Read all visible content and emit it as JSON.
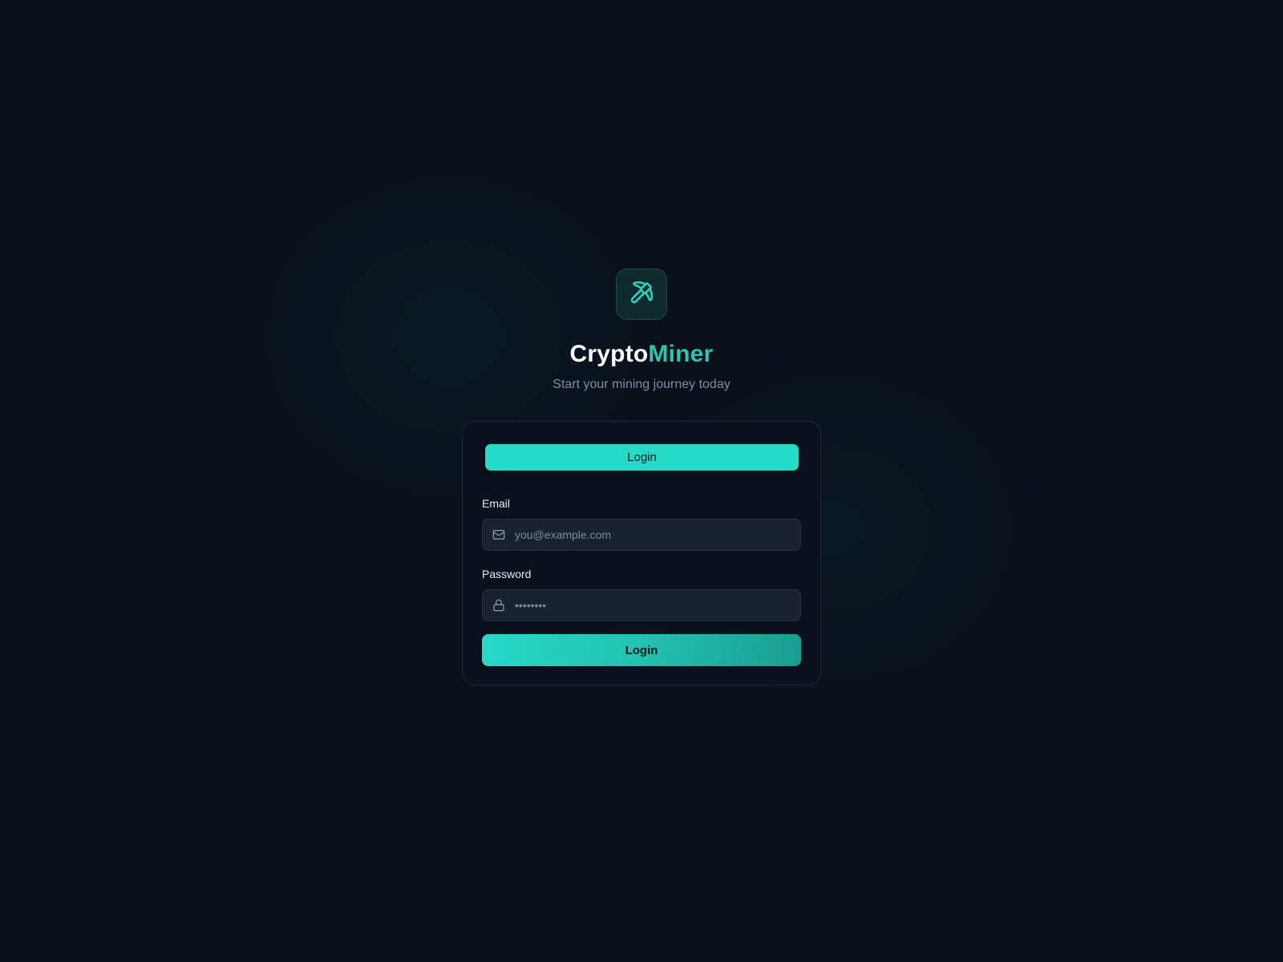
{
  "brand": {
    "name_part1": "Crypto",
    "name_part2": "Miner",
    "tagline": "Start your mining journey today",
    "logo_icon": "pickaxe-icon",
    "accent_color": "#2bc5b1"
  },
  "auth_card": {
    "tabs": [
      {
        "label": "Login",
        "active": true
      }
    ],
    "email": {
      "label": "Email",
      "placeholder": "you@example.com",
      "value": "",
      "icon": "mail-icon"
    },
    "password": {
      "label": "Password",
      "placeholder": "••••••••",
      "value": "",
      "icon": "lock-icon"
    },
    "submit_label": "Login"
  },
  "colors": {
    "background": "#0a0f1a",
    "card": "#0c111c",
    "primary": "#26dac8",
    "primary_dark": "#1a9d91",
    "input_bg": "#1a2130",
    "muted_text": "#7e8ca6"
  }
}
